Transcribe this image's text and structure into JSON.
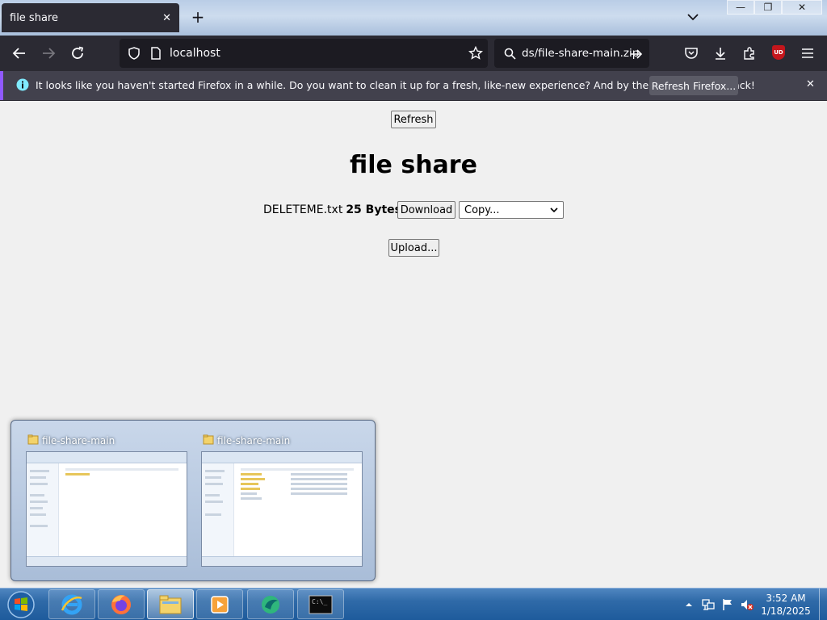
{
  "browser": {
    "tab_title": "file share",
    "tab_close": "✕",
    "new_tab": "+",
    "url": "localhost",
    "search_text": "ds/file-share-main.zip",
    "ublock_label": "UD",
    "window_controls": {
      "minimize": "—",
      "restore": "❐",
      "close": "✕"
    }
  },
  "notification": {
    "message": "It looks like you haven't started Firefox in a while. Do you want to clean it up for a fresh, like-new experience? And by the way, welcome back!",
    "action_label": "Refresh Firefox...",
    "close": "✕",
    "accent_color": "#9059ff"
  },
  "page": {
    "refresh_label": "Refresh",
    "title": "file share",
    "files": [
      {
        "name": "DELETEME.txt",
        "size": "25 Bytes",
        "download_label": "Download",
        "copy_selected": "Copy..."
      }
    ],
    "upload_label": "Upload..."
  },
  "thumbnails": [
    {
      "title": "file-share-main"
    },
    {
      "title": "file-share-main"
    }
  ],
  "taskbar": {
    "items": [
      "start-orb",
      "internet-explorer",
      "firefox",
      "windows-explorer",
      "media-player",
      "app-green",
      "command-prompt"
    ],
    "clock_time": "3:52 AM",
    "clock_date": "1/18/2025"
  }
}
